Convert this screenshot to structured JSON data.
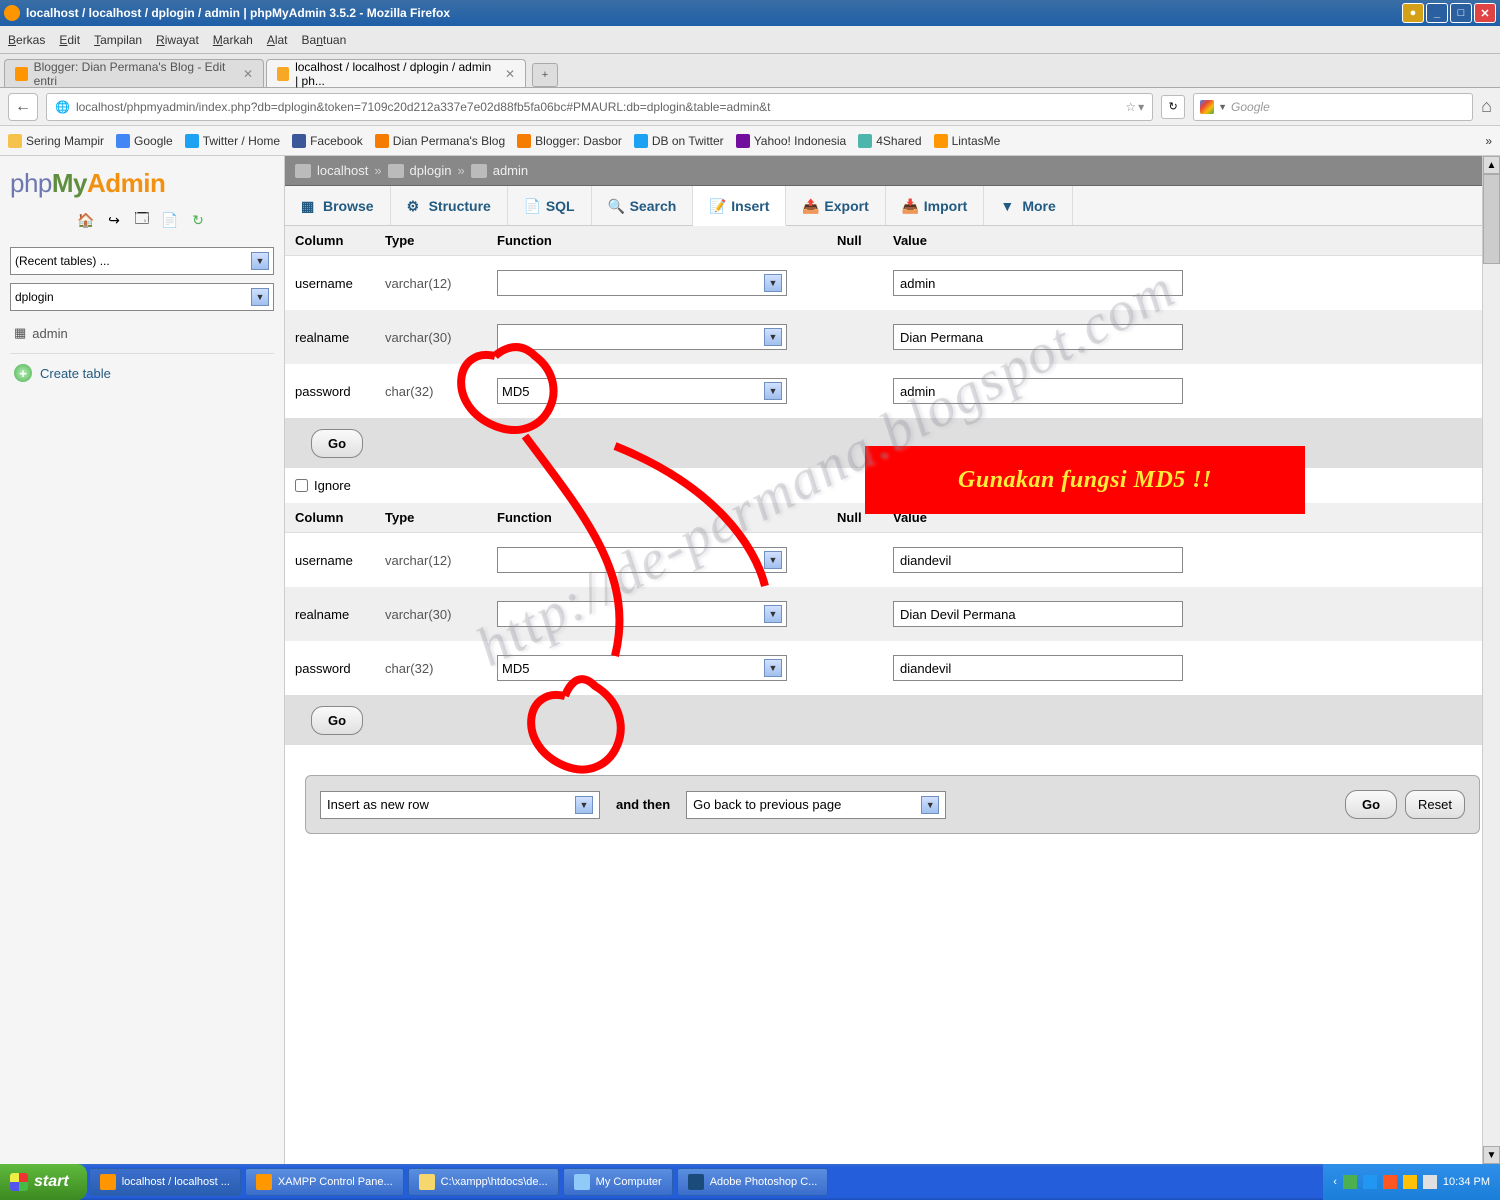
{
  "window": {
    "title": "localhost / localhost / dplogin / admin | phpMyAdmin 3.5.2 - Mozilla Firefox"
  },
  "menubar": [
    "Berkas",
    "Edit",
    "Tampilan",
    "Riwayat",
    "Markah",
    "Alat",
    "Bantuan"
  ],
  "tabs": [
    {
      "label": "Blogger: Dian Permana's Blog - Edit entri",
      "active": false
    },
    {
      "label": "localhost / localhost / dplogin / admin | ph...",
      "active": true
    }
  ],
  "address": {
    "url": "localhost/phpmyadmin/index.php?db=dplogin&token=7109c20d212a337e7e02d88fb5fa06bc#PMAURL:db=dplogin&table=admin&t",
    "search_placeholder": "Google"
  },
  "bookmarks": [
    {
      "label": "Sering Mampir",
      "color": "#f5c24c"
    },
    {
      "label": "Google",
      "color": "#4285f4"
    },
    {
      "label": "Twitter / Home",
      "color": "#1da1f2"
    },
    {
      "label": "Facebook",
      "color": "#3b5998"
    },
    {
      "label": "Dian Permana's Blog",
      "color": "#f57c00"
    },
    {
      "label": "Blogger: Dasbor",
      "color": "#f57c00"
    },
    {
      "label": "DB on Twitter",
      "color": "#1da1f2"
    },
    {
      "label": "Yahoo! Indonesia",
      "color": "#720e9e"
    },
    {
      "label": "4Shared",
      "color": "#4db6ac"
    },
    {
      "label": "LintasMe",
      "color": "#ff9800"
    }
  ],
  "sidebar": {
    "logo_parts": {
      "php": "php",
      "my": "My",
      "admin": "Admin"
    },
    "recent_label": "(Recent tables) ...",
    "db_label": "dplogin",
    "table_label": "admin",
    "create_label": "Create table"
  },
  "breadcrumb": {
    "host": "localhost",
    "db": "dplogin",
    "table": "admin"
  },
  "pma_tabs": [
    "Browse",
    "Structure",
    "SQL",
    "Search",
    "Insert",
    "Export",
    "Import",
    "More"
  ],
  "pma_active_tab": "Insert",
  "headers": {
    "column": "Column",
    "type": "Type",
    "function": "Function",
    "null": "Null",
    "value": "Value"
  },
  "rows1": [
    {
      "column": "username",
      "type": "varchar(12)",
      "function": "",
      "value": "admin"
    },
    {
      "column": "realname",
      "type": "varchar(30)",
      "function": "",
      "value": "Dian Permana"
    },
    {
      "column": "password",
      "type": "char(32)",
      "function": "MD5",
      "value": "admin"
    }
  ],
  "rows2": [
    {
      "column": "username",
      "type": "varchar(12)",
      "function": "",
      "value": "diandevil"
    },
    {
      "column": "realname",
      "type": "varchar(30)",
      "function": "",
      "value": "Dian Devil Permana"
    },
    {
      "column": "password",
      "type": "char(32)",
      "function": "MD5",
      "value": "diandevil"
    }
  ],
  "go_label": "Go",
  "ignore_label": "Ignore",
  "bottom": {
    "insert_as": "Insert as new row",
    "and_then": "and then",
    "go_back": "Go back to previous page",
    "go": "Go",
    "reset": "Reset"
  },
  "annotation": {
    "banner": "Gunakan fungsi MD5 !!",
    "watermark": "http://de-permana.blogspot.com"
  },
  "taskbar": {
    "start": "start",
    "items": [
      {
        "label": "localhost / localhost ...",
        "color": "#ff9500"
      },
      {
        "label": "XAMPP Control Pane...",
        "color": "#ff9800"
      },
      {
        "label": "C:\\xampp\\htdocs\\de...",
        "color": "#f5d76e"
      },
      {
        "label": "My Computer",
        "color": "#90caf9"
      },
      {
        "label": "Adobe Photoshop C...",
        "color": "#1a4b7a"
      }
    ],
    "time": "10:34 PM"
  }
}
